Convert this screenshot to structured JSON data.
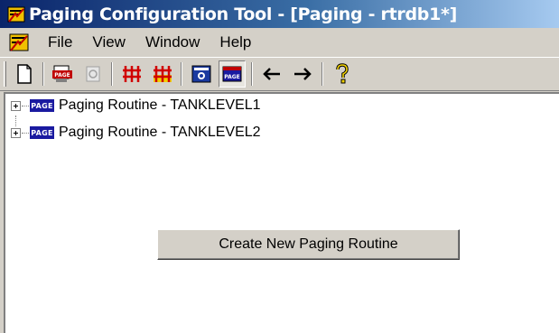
{
  "window": {
    "title": "Paging Configuration Tool - [Paging - rtrdb1*]",
    "app_icon": "paging-app-icon"
  },
  "menubar": {
    "doc_icon": "document-window-icon",
    "items": [
      {
        "label": "File"
      },
      {
        "label": "View"
      },
      {
        "label": "Window"
      },
      {
        "label": "Help"
      }
    ]
  },
  "toolbar": {
    "buttons": [
      {
        "icon": "new-document-icon"
      },
      {
        "icon": "page-red-icon"
      },
      {
        "icon": "page-disabled-icon"
      },
      {
        "icon": "red-grid-icon"
      },
      {
        "icon": "red-grid-yellow-icon"
      },
      {
        "icon": "blue-view-icon"
      },
      {
        "icon": "page-view-icon",
        "pressed": true
      },
      {
        "icon": "arrow-left-icon"
      },
      {
        "icon": "arrow-right-icon"
      },
      {
        "icon": "help-icon"
      }
    ]
  },
  "tree": {
    "node_badge": "PAGE",
    "items": [
      {
        "label": "Paging Routine - TANKLEVEL1"
      },
      {
        "label": "Paging Routine - TANKLEVEL2"
      }
    ]
  },
  "main": {
    "create_button_label": "Create New Paging Routine"
  },
  "colors": {
    "title_gradient_start": "#0a246a",
    "title_gradient_end": "#a6caf0",
    "chrome": "#d4d0c8",
    "page_icon_bg": "#1a1aa0"
  }
}
